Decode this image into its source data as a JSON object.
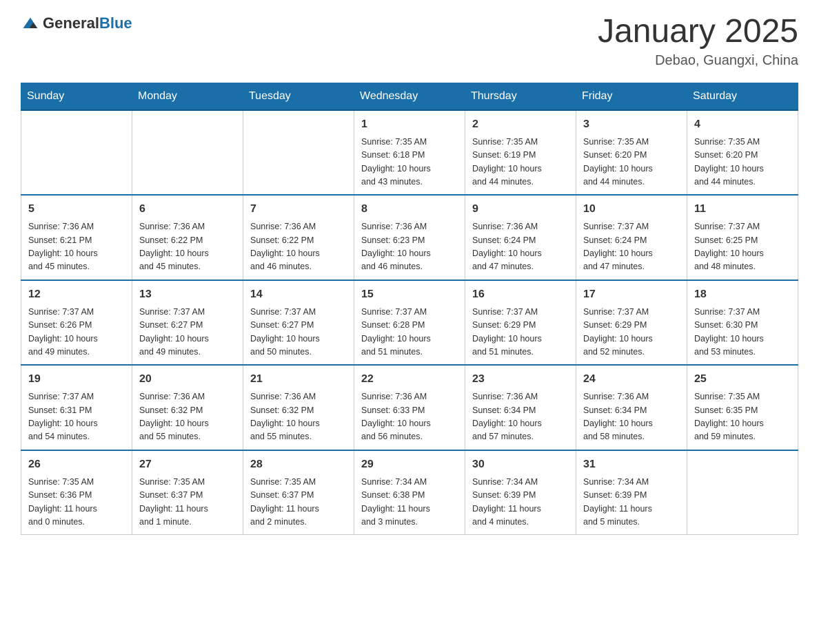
{
  "header": {
    "logo": {
      "text_general": "General",
      "text_blue": "Blue"
    },
    "title": "January 2025",
    "location": "Debao, Guangxi, China"
  },
  "calendar": {
    "days_of_week": [
      "Sunday",
      "Monday",
      "Tuesday",
      "Wednesday",
      "Thursday",
      "Friday",
      "Saturday"
    ],
    "weeks": [
      [
        {
          "day": "",
          "info": ""
        },
        {
          "day": "",
          "info": ""
        },
        {
          "day": "",
          "info": ""
        },
        {
          "day": "1",
          "info": "Sunrise: 7:35 AM\nSunset: 6:18 PM\nDaylight: 10 hours\nand 43 minutes."
        },
        {
          "day": "2",
          "info": "Sunrise: 7:35 AM\nSunset: 6:19 PM\nDaylight: 10 hours\nand 44 minutes."
        },
        {
          "day": "3",
          "info": "Sunrise: 7:35 AM\nSunset: 6:20 PM\nDaylight: 10 hours\nand 44 minutes."
        },
        {
          "day": "4",
          "info": "Sunrise: 7:35 AM\nSunset: 6:20 PM\nDaylight: 10 hours\nand 44 minutes."
        }
      ],
      [
        {
          "day": "5",
          "info": "Sunrise: 7:36 AM\nSunset: 6:21 PM\nDaylight: 10 hours\nand 45 minutes."
        },
        {
          "day": "6",
          "info": "Sunrise: 7:36 AM\nSunset: 6:22 PM\nDaylight: 10 hours\nand 45 minutes."
        },
        {
          "day": "7",
          "info": "Sunrise: 7:36 AM\nSunset: 6:22 PM\nDaylight: 10 hours\nand 46 minutes."
        },
        {
          "day": "8",
          "info": "Sunrise: 7:36 AM\nSunset: 6:23 PM\nDaylight: 10 hours\nand 46 minutes."
        },
        {
          "day": "9",
          "info": "Sunrise: 7:36 AM\nSunset: 6:24 PM\nDaylight: 10 hours\nand 47 minutes."
        },
        {
          "day": "10",
          "info": "Sunrise: 7:37 AM\nSunset: 6:24 PM\nDaylight: 10 hours\nand 47 minutes."
        },
        {
          "day": "11",
          "info": "Sunrise: 7:37 AM\nSunset: 6:25 PM\nDaylight: 10 hours\nand 48 minutes."
        }
      ],
      [
        {
          "day": "12",
          "info": "Sunrise: 7:37 AM\nSunset: 6:26 PM\nDaylight: 10 hours\nand 49 minutes."
        },
        {
          "day": "13",
          "info": "Sunrise: 7:37 AM\nSunset: 6:27 PM\nDaylight: 10 hours\nand 49 minutes."
        },
        {
          "day": "14",
          "info": "Sunrise: 7:37 AM\nSunset: 6:27 PM\nDaylight: 10 hours\nand 50 minutes."
        },
        {
          "day": "15",
          "info": "Sunrise: 7:37 AM\nSunset: 6:28 PM\nDaylight: 10 hours\nand 51 minutes."
        },
        {
          "day": "16",
          "info": "Sunrise: 7:37 AM\nSunset: 6:29 PM\nDaylight: 10 hours\nand 51 minutes."
        },
        {
          "day": "17",
          "info": "Sunrise: 7:37 AM\nSunset: 6:29 PM\nDaylight: 10 hours\nand 52 minutes."
        },
        {
          "day": "18",
          "info": "Sunrise: 7:37 AM\nSunset: 6:30 PM\nDaylight: 10 hours\nand 53 minutes."
        }
      ],
      [
        {
          "day": "19",
          "info": "Sunrise: 7:37 AM\nSunset: 6:31 PM\nDaylight: 10 hours\nand 54 minutes."
        },
        {
          "day": "20",
          "info": "Sunrise: 7:36 AM\nSunset: 6:32 PM\nDaylight: 10 hours\nand 55 minutes."
        },
        {
          "day": "21",
          "info": "Sunrise: 7:36 AM\nSunset: 6:32 PM\nDaylight: 10 hours\nand 55 minutes."
        },
        {
          "day": "22",
          "info": "Sunrise: 7:36 AM\nSunset: 6:33 PM\nDaylight: 10 hours\nand 56 minutes."
        },
        {
          "day": "23",
          "info": "Sunrise: 7:36 AM\nSunset: 6:34 PM\nDaylight: 10 hours\nand 57 minutes."
        },
        {
          "day": "24",
          "info": "Sunrise: 7:36 AM\nSunset: 6:34 PM\nDaylight: 10 hours\nand 58 minutes."
        },
        {
          "day": "25",
          "info": "Sunrise: 7:35 AM\nSunset: 6:35 PM\nDaylight: 10 hours\nand 59 minutes."
        }
      ],
      [
        {
          "day": "26",
          "info": "Sunrise: 7:35 AM\nSunset: 6:36 PM\nDaylight: 11 hours\nand 0 minutes."
        },
        {
          "day": "27",
          "info": "Sunrise: 7:35 AM\nSunset: 6:37 PM\nDaylight: 11 hours\nand 1 minute."
        },
        {
          "day": "28",
          "info": "Sunrise: 7:35 AM\nSunset: 6:37 PM\nDaylight: 11 hours\nand 2 minutes."
        },
        {
          "day": "29",
          "info": "Sunrise: 7:34 AM\nSunset: 6:38 PM\nDaylight: 11 hours\nand 3 minutes."
        },
        {
          "day": "30",
          "info": "Sunrise: 7:34 AM\nSunset: 6:39 PM\nDaylight: 11 hours\nand 4 minutes."
        },
        {
          "day": "31",
          "info": "Sunrise: 7:34 AM\nSunset: 6:39 PM\nDaylight: 11 hours\nand 5 minutes."
        },
        {
          "day": "",
          "info": ""
        }
      ]
    ]
  }
}
